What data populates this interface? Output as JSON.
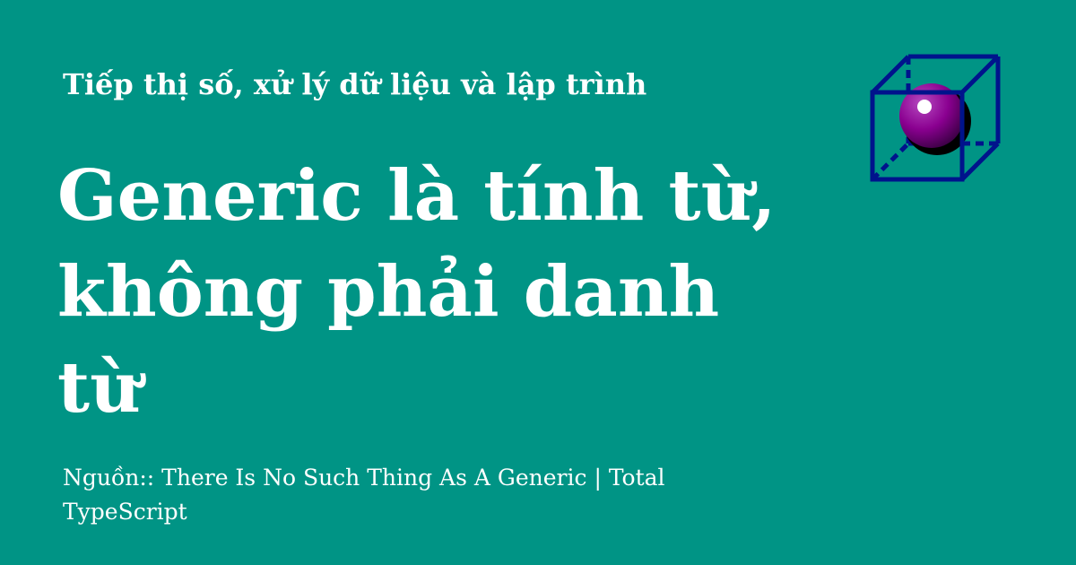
{
  "site": {
    "name": "Tiếp thị số, xử lý dữ liệu và lập trình"
  },
  "article": {
    "title": "Generic là tính từ, không phải danh từ",
    "source": "Nguồn:: There Is No Such Thing As A Generic | Total TypeScript"
  },
  "logo": {
    "icon": "cube-sphere-logo-icon"
  },
  "colors": {
    "background": "#009485",
    "text": "#ffffff",
    "cube": "#00138c",
    "sphere": "#8a0090"
  }
}
